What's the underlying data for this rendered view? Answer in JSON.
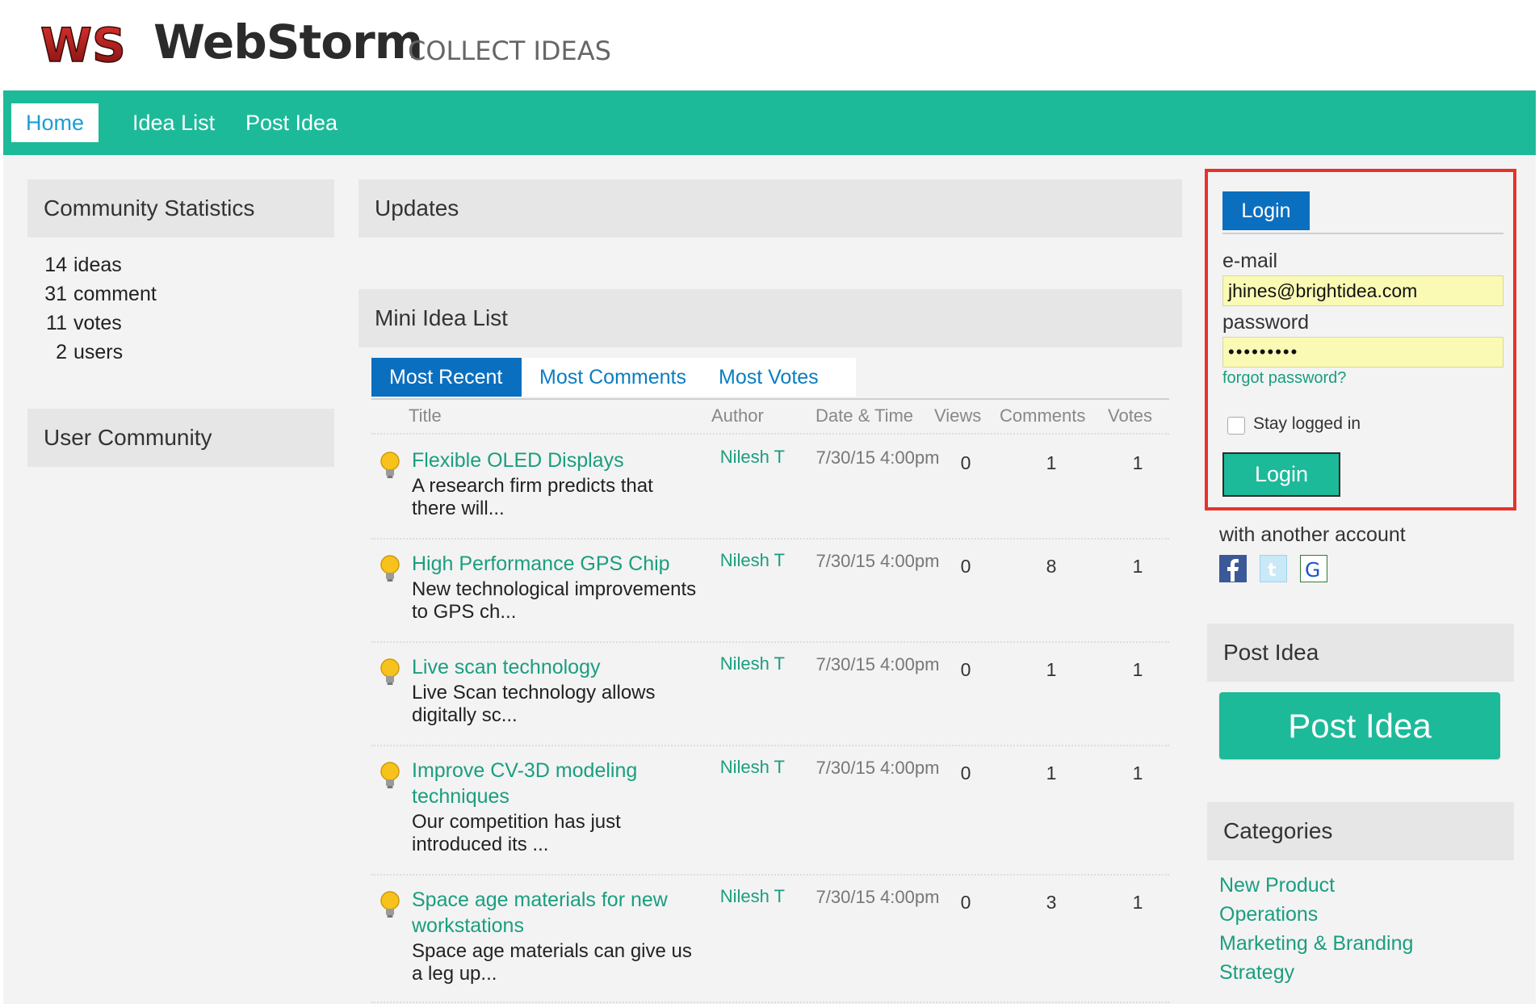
{
  "header": {
    "logo_mark": "WS",
    "logo_word": "WebStorm",
    "tagline": "COLLECT IDEAS"
  },
  "nav": {
    "items": [
      {
        "label": "Home"
      },
      {
        "label": "Idea List"
      },
      {
        "label": "Post Idea"
      }
    ],
    "active": "Home"
  },
  "left": {
    "stats_title": "Community Statistics",
    "stats": [
      {
        "num": "14",
        "label": "ideas"
      },
      {
        "num": "31",
        "label": "comment"
      },
      {
        "num": "11",
        "label": "votes"
      },
      {
        "num": "2",
        "label": "users"
      }
    ],
    "community_title": "User Community"
  },
  "center": {
    "updates_title": "Updates",
    "mini_title": "Mini Idea List",
    "tabs": [
      {
        "label": "Most Recent"
      },
      {
        "label": "Most Comments"
      },
      {
        "label": "Most Votes"
      }
    ],
    "active_tab": "Most Recent",
    "columns": {
      "title": "Title",
      "author": "Author",
      "date": "Date & Time",
      "views": "Views",
      "comments": "Comments",
      "votes": "Votes"
    },
    "rows": [
      {
        "title": "Flexible OLED Displays",
        "desc": "A research firm predicts that there will...",
        "author": "Nilesh T",
        "date": "7/30/15 4:00pm",
        "views": "0",
        "comments": "1",
        "votes": "1"
      },
      {
        "title": "High Performance GPS Chip",
        "desc": "New technological improvements to GPS ch...",
        "author": "Nilesh T",
        "date": "7/30/15 4:00pm",
        "views": "0",
        "comments": "8",
        "votes": "1"
      },
      {
        "title": "Live scan technology",
        "desc": "Live Scan technology allows digitally sc...",
        "author": "Nilesh T",
        "date": "7/30/15 4:00pm",
        "views": "0",
        "comments": "1",
        "votes": "1"
      },
      {
        "title": "Improve CV-3D modeling techniques",
        "desc": "Our competition has just introduced its ...",
        "author": "Nilesh T",
        "date": "7/30/15 4:00pm",
        "views": "0",
        "comments": "1",
        "votes": "1"
      },
      {
        "title": "Space age materials for new workstations",
        "desc": "Space age materials can give us a leg up...",
        "author": "Nilesh T",
        "date": "7/30/15 4:00pm",
        "views": "0",
        "comments": "3",
        "votes": "1"
      }
    ]
  },
  "login": {
    "tab_label": "Login",
    "email_label": "e-mail",
    "email_value": "jhines@brightidea.com",
    "password_label": "password",
    "password_value": "•••••••••",
    "forgot": "forgot password?",
    "stay_label": "Stay logged in",
    "stay_checked": false,
    "button": "Login",
    "alt_label": "with another account",
    "social": [
      "facebook-icon",
      "twitter-icon",
      "google-icon"
    ]
  },
  "right": {
    "post_title": "Post Idea",
    "post_button": "Post Idea",
    "categories_title": "Categories",
    "categories": [
      "New Product",
      "Operations",
      "Marketing & Branding",
      "Strategy"
    ]
  },
  "colors": {
    "brand_green": "#1dba9a",
    "brand_blue": "#0b6fbf",
    "link_green": "#1a9e80",
    "highlight_red": "#e8312b"
  }
}
